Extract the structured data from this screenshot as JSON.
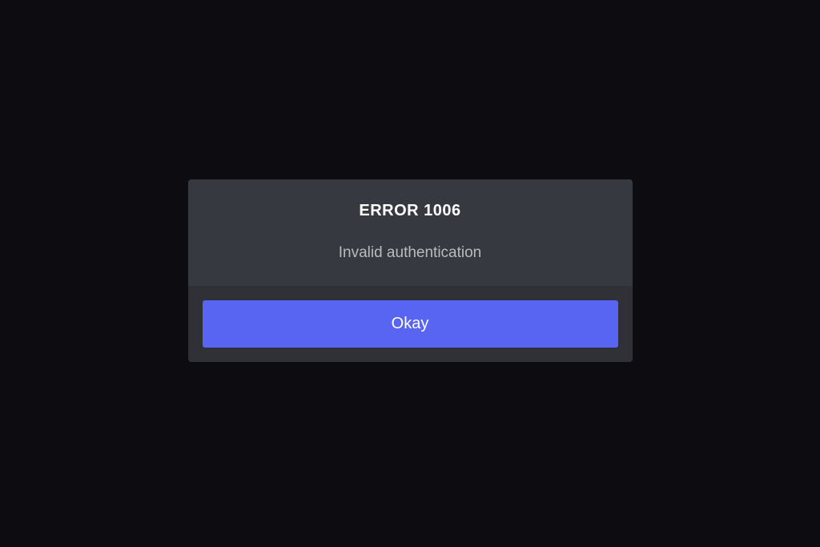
{
  "modal": {
    "title": "ERROR 1006",
    "message": "Invalid authentication",
    "button_label": "Okay"
  }
}
